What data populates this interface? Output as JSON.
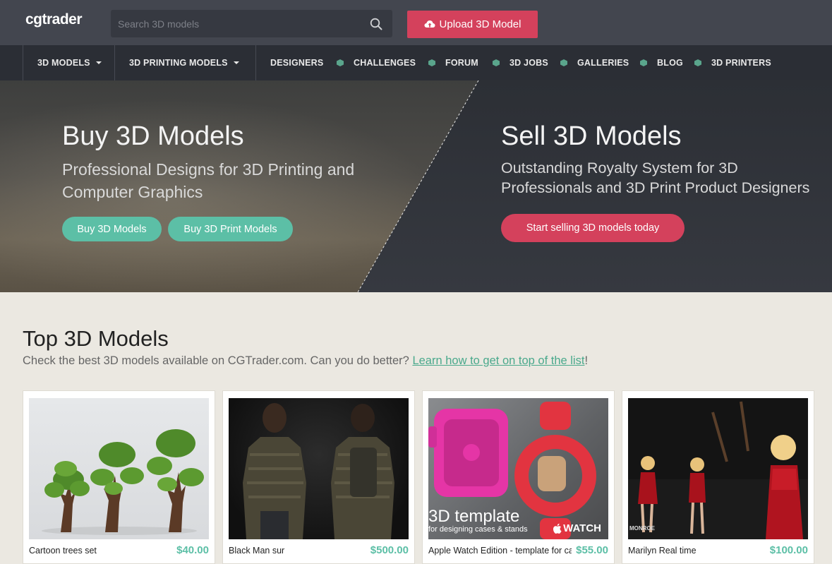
{
  "header": {
    "logo": "cgtrader",
    "search_placeholder": "Search 3D models",
    "upload_label": "Upload 3D Model"
  },
  "nav": {
    "items": [
      {
        "label": "3D MODELS",
        "dropdown": true
      },
      {
        "label": "3D PRINTING MODELS",
        "dropdown": true
      },
      {
        "label": "DESIGNERS"
      },
      {
        "label": "CHALLENGES"
      },
      {
        "label": "FORUM"
      },
      {
        "label": "3D JOBS"
      },
      {
        "label": "GALLERIES"
      },
      {
        "label": "BLOG"
      },
      {
        "label": "3D PRINTERS"
      }
    ]
  },
  "hero": {
    "buy": {
      "title": "Buy 3D Models",
      "subtitle": "Professional Designs for 3D Printing and Computer Graphics",
      "btn_models": "Buy 3D Models",
      "btn_print": "Buy 3D Print Models"
    },
    "sell": {
      "title": "Sell 3D Models",
      "subtitle": "Outstanding Royalty System for 3D Professionals and 3D Print Product Designers",
      "btn_sell": "Start selling 3D models today"
    }
  },
  "top_models": {
    "title": "Top 3D Models",
    "desc": "Check the best 3D models available on CGTrader.com. Can you do better? ",
    "link": "Learn how to get on top of the list",
    "desc_end": "!",
    "items": [
      {
        "title": "Cartoon trees set",
        "price": "$40.00"
      },
      {
        "title": "Black Man sur",
        "price": "$500.00"
      },
      {
        "title": "Apple Watch Edition - template for ca",
        "price": "$55.00",
        "overlay": "3D template",
        "overlay_sub": "for designing cases & stands",
        "overlay_brand": "WATCH"
      },
      {
        "title": "Marilyn Real time",
        "price": "$100.00",
        "overlay": "MONROE"
      }
    ]
  },
  "colors": {
    "header_bg": "#43464f",
    "nav_bg": "#2b2e35",
    "accent_red": "#d4415c",
    "accent_green": "#5cbfa6",
    "page_bg": "#ebe8e1"
  }
}
